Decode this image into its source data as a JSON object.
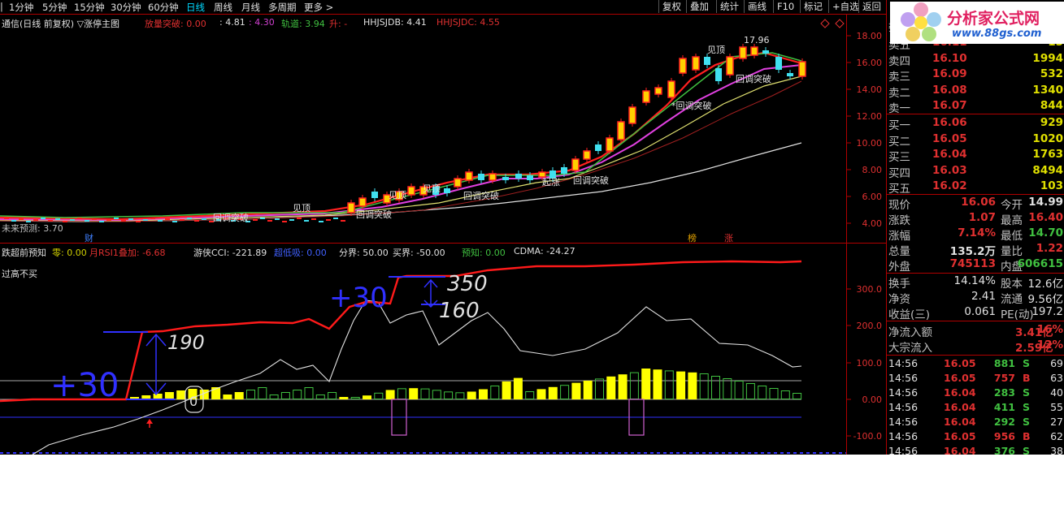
{
  "toolbar": {
    "periods": [
      "1分钟",
      "5分钟",
      "15分钟",
      "30分钟",
      "60分钟",
      "日线",
      "周线",
      "月线",
      "多周期",
      "更多 >"
    ],
    "active_period": "日线",
    "buttons": [
      "复权",
      "叠加",
      "统计",
      "画线",
      "F10",
      "标记",
      "+自选",
      "返回"
    ]
  },
  "main_info": {
    "title": "通信(日线 前复权) ▽涨停主图",
    "items": [
      {
        "label": "放量突破: 0.00",
        "color": "#e03030"
      },
      {
        "label": ": 4.81",
        "color": "#e0e0e0"
      },
      {
        "label": ": 4.30",
        "color": "#d040d0"
      },
      {
        "label": "轨道: 3.94",
        "color": "#40c040"
      },
      {
        "label": "升: -",
        "color": "#e03030"
      },
      {
        "label": "HHJSJDB: 4.41",
        "color": "#e0e0e0"
      },
      {
        "label": "HHJSJDC: 4.55",
        "color": "#e03030"
      }
    ]
  },
  "price_axis": [
    "18.00",
    "16.00",
    "14.00",
    "12.00",
    "10.00",
    "8.00",
    "6.00",
    "4.00"
  ],
  "price_annotations": {
    "peak": "17.96",
    "top1": "见顶",
    "top2": "见顶",
    "top3": "见顶",
    "top4": "见顶",
    "break1": "回调突破",
    "break2": "*回调突破",
    "break3": "回调突破",
    "break4": "回调突破",
    "break5": "回调突破",
    "break6": "回调突破",
    "start": "起涨",
    "left_label": "未来预测: 3.70",
    "fin_marker": "财",
    "mark_a": "榜",
    "mark_b": "涨"
  },
  "sub_info": {
    "title": "跌超前预知",
    "items": [
      {
        "label": "零: 0.00",
        "color": "#d0d000"
      },
      {
        "label": "月RSI1叠加: -6.68",
        "color": "#e03030"
      },
      {
        "label": "游侠CCI: -221.89",
        "color": "#e0e0e0"
      },
      {
        "label": "超低吸: 0.00",
        "color": "#4060ff"
      },
      {
        "label": "分界: 50.00",
        "color": "#e0e0e0"
      },
      {
        "label": "买界: -50.00",
        "color": "#e0e0e0"
      },
      {
        "label": "预知: 0.00",
        "color": "#40c040"
      },
      {
        "label": "CDMA: -24.27",
        "color": "#e0e0e0"
      }
    ],
    "warning": "过高不买"
  },
  "sub_axis": [
    "300.0",
    "200.0",
    "100.0",
    "0.00",
    "-100.0"
  ],
  "handwriting": {
    "plus1": "+30",
    "val1": "190",
    "plus2": "+30",
    "val2": "350",
    "val3": "160",
    "zero": "0"
  },
  "quote": {
    "header": "委",
    "asks": [
      {
        "label": "卖五",
        "price": "16.11",
        "vol": "15"
      },
      {
        "label": "卖四",
        "price": "16.10",
        "vol": "1994"
      },
      {
        "label": "卖三",
        "price": "16.09",
        "vol": "532"
      },
      {
        "label": "卖二",
        "price": "16.08",
        "vol": "1340"
      },
      {
        "label": "卖一",
        "price": "16.07",
        "vol": "844"
      }
    ],
    "bids": [
      {
        "label": "买一",
        "price": "16.06",
        "vol": "929"
      },
      {
        "label": "买二",
        "price": "16.05",
        "vol": "1020"
      },
      {
        "label": "买三",
        "price": "16.04",
        "vol": "1763"
      },
      {
        "label": "买四",
        "price": "16.03",
        "vol": "8494"
      },
      {
        "label": "买五",
        "price": "16.02",
        "vol": "103"
      }
    ],
    "stats": [
      {
        "l1": "现价",
        "v1": "16.06",
        "c1": "#e03030",
        "l2": "今开",
        "v2": "14.99",
        "c2": "#e0e0e0"
      },
      {
        "l1": "涨跌",
        "v1": "1.07",
        "c1": "#e03030",
        "l2": "最高",
        "v2": "16.40",
        "c2": "#e03030"
      },
      {
        "l1": "涨幅",
        "v1": "7.14%",
        "c1": "#e03030",
        "l2": "最低",
        "v2": "14.70",
        "c2": "#40c040"
      },
      {
        "l1": "总量",
        "v1": "135.2万",
        "c1": "#e0e0e0",
        "l2": "量比",
        "v2": "1.22",
        "c2": "#e03030"
      },
      {
        "l1": "外盘",
        "v1": "745113",
        "c1": "#e03030",
        "l2": "内盘",
        "v2": "606615",
        "c2": "#40c040"
      }
    ],
    "fundamentals": [
      {
        "l1": "换手",
        "v1": "14.14%",
        "l2": "股本",
        "v2": "12.6亿"
      },
      {
        "l1": "净资",
        "v1": "2.41",
        "l2": "流通",
        "v2": "9.56亿"
      },
      {
        "l1": "收益(三)",
        "v1": "0.061",
        "l2": "PE(动)",
        "v2": "197.2"
      }
    ],
    "flows": [
      {
        "label": "净流入额",
        "value": "3.41亿",
        "pct": "16%"
      },
      {
        "label": "大宗流入",
        "value": "2.59亿",
        "pct": "12%"
      }
    ],
    "ticks": [
      {
        "time": "14:56",
        "price": "16.05",
        "vol": "881",
        "side": "S",
        "n": "69"
      },
      {
        "time": "14:56",
        "price": "16.05",
        "vol": "757",
        "side": "B",
        "n": "63"
      },
      {
        "time": "14:56",
        "price": "16.04",
        "vol": "283",
        "side": "S",
        "n": "40"
      },
      {
        "time": "14:56",
        "price": "16.04",
        "vol": "411",
        "side": "S",
        "n": "55"
      },
      {
        "time": "14:56",
        "price": "16.04",
        "vol": "292",
        "side": "S",
        "n": "27"
      },
      {
        "time": "14:56",
        "price": "16.05",
        "vol": "956",
        "side": "B",
        "n": "62"
      },
      {
        "time": "14:56",
        "price": "16.04",
        "vol": "376",
        "side": "S",
        "n": "38"
      }
    ]
  },
  "watermark": {
    "text": "分析家公式网",
    "url": "www.88gs.com"
  },
  "colors": {
    "up": "#e03030",
    "down": "#40c040",
    "accent": "#00d8ff",
    "frame": "#b00000"
  }
}
